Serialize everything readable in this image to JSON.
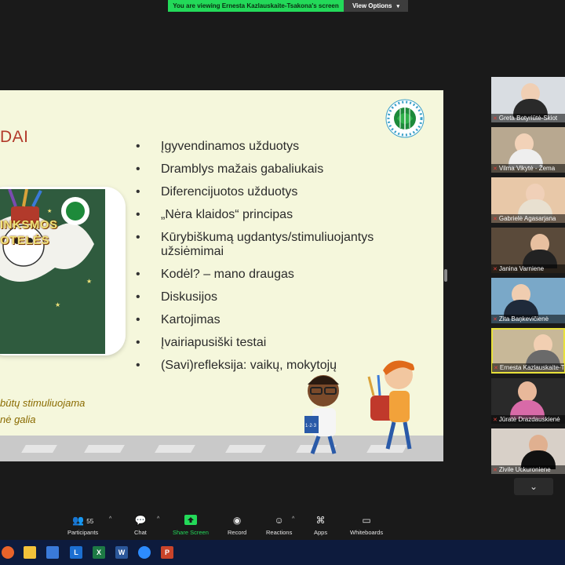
{
  "banner": {
    "message": "You are viewing Ernesta Kazlauskaite-Tsakona's screen",
    "view_options": "View Options"
  },
  "slide": {
    "title": "DAI",
    "bullets": [
      "Įgyvendinamos užduotys",
      "Dramblys mažais gabaliukais",
      "Diferencijuotos užduotys",
      "„Nėra klaidos“ principas",
      "Kūrybiškumą ugdantys/stimuliuojantys užsiėmimai",
      "Kodėl? – mano draugas",
      "Diskusijos",
      "Kartojimas",
      "Įvairiapusiški testai",
      "(Savi)refleksija: vaikų, mokytojų"
    ],
    "card_title_line1": "INKSMOS",
    "card_title_line2": "OTELĖS",
    "footer_line1": "būtų stimuliuojama",
    "footer_line2": "nė galia",
    "kid_book_label": "1·2·3"
  },
  "participants": [
    {
      "name": "Greta Botyriūtė-Skiot"
    },
    {
      "name": "Vilma Vikytė - Žema"
    },
    {
      "name": "Gabrielė Agasarjana"
    },
    {
      "name": "Janina Varniene"
    },
    {
      "name": "Zita Baņkevičienė"
    },
    {
      "name": "Ernesta Kazlauskaite-Tsa",
      "active": true
    },
    {
      "name": "Jūratė Drazdauskienė"
    },
    {
      "name": "Zivile Uckuroniene"
    }
  ],
  "toolbar": {
    "participants_label": "Participants",
    "participants_count": "55",
    "chat_label": "Chat",
    "share_label": "Share Screen",
    "record_label": "Record",
    "reactions_label": "Reactions",
    "apps_label": "Apps",
    "whiteboards_label": "Whiteboards"
  },
  "taskbar": {
    "l_app": "L",
    "excel": "X",
    "word": "W",
    "ppt": "P"
  },
  "colors": {
    "share_green": "#23d959",
    "slide_bg": "#f5f7dc",
    "title_red": "#b23a2b",
    "active_tile": "#e8e13a"
  }
}
